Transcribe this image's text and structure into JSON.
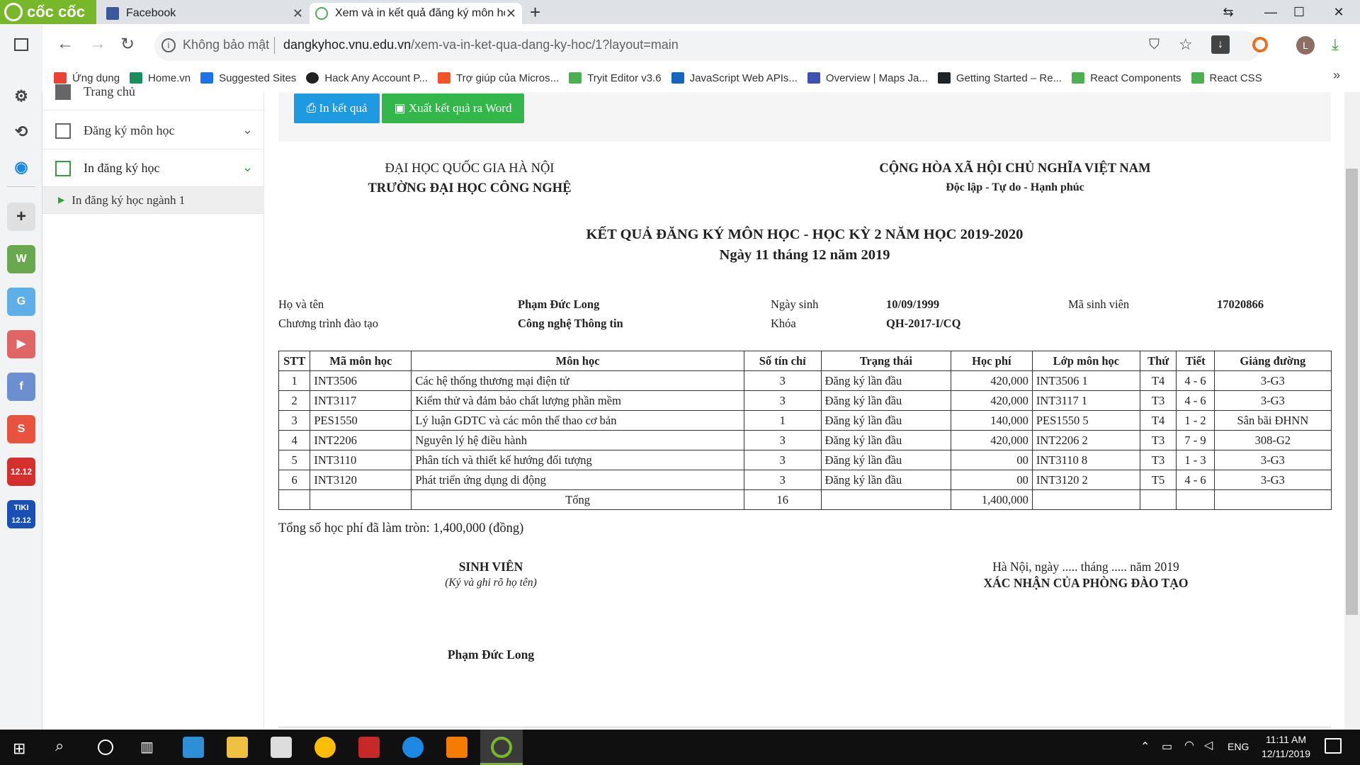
{
  "browser": {
    "brand": "cốc cốc",
    "tabs": [
      {
        "title": "Facebook",
        "favicon": "facebook-icon"
      },
      {
        "title": "Xem và in kết quả đăng ký môn họ",
        "favicon": "vnu-icon"
      }
    ],
    "security_label": "Không bảo mật",
    "url_host": "dangkyhoc.vnu.edu.vn",
    "url_path": "/xem-va-in-ket-qua-dang-ky-hoc/1?layout=main",
    "profile_initial": "L",
    "bookmarks": [
      {
        "label": "Ứng dụng",
        "color": "#e94335"
      },
      {
        "label": "Home.vn",
        "color": "#1a8f5c"
      },
      {
        "label": "Suggested Sites",
        "color": "#1a73e8"
      },
      {
        "label": "Hack Any Account P...",
        "color": "#222222"
      },
      {
        "label": "Trợ giúp của Micros...",
        "color": "#f35325"
      },
      {
        "label": "Tryit Editor v3.6",
        "color": "#4caf50"
      },
      {
        "label": "JavaScript Web APIs...",
        "color": "#1565c0"
      },
      {
        "label": "Overview | Maps Ja...",
        "color": "#3f51b5"
      },
      {
        "label": "Getting Started – Re...",
        "color": "#20232a"
      },
      {
        "label": "React Components",
        "color": "#4caf50"
      },
      {
        "label": "React CSS",
        "color": "#4caf50"
      }
    ]
  },
  "sidebar": {
    "items": [
      {
        "label": "Trang chủ"
      },
      {
        "label": "Đăng ký môn học"
      },
      {
        "label": "In đăng ký học"
      },
      {
        "label": "In đăng ký học ngành 1"
      }
    ]
  },
  "actions": {
    "print_label": "In kết quả",
    "export_label": "Xuất kết quả ra Word"
  },
  "header": {
    "left_line1": "ĐẠI HỌC QUỐC GIA HÀ NỘI",
    "left_line2": "TRƯỜNG ĐẠI HỌC CÔNG NGHỆ",
    "right_line1": "CỘNG HÒA XÃ HỘI CHỦ NGHĨA VIỆT NAM",
    "right_line2": "Độc lập - Tự do - Hạnh phúc",
    "title": "KẾT QUẢ ĐĂNG KÝ MÔN HỌC - HỌC KỲ 2 NĂM HỌC 2019-2020",
    "date": "Ngày 11 tháng 12 năm 2019"
  },
  "student": {
    "name_label": "Họ và tên",
    "name": "Phạm Đức Long",
    "dob_label": "Ngày sinh",
    "dob": "10/09/1999",
    "id_label": "Mã sinh viên",
    "id": "17020866",
    "program_label": "Chương trình đào tạo",
    "program": "Công nghệ Thông tin",
    "cohort_label": "Khóa",
    "cohort": "QH-2017-I/CQ"
  },
  "table": {
    "headers": [
      "STT",
      "Mã môn học",
      "Môn học",
      "Số tín chỉ",
      "Trạng thái",
      "Học phí",
      "Lớp môn học",
      "Thứ",
      "Tiết",
      "Giảng đường"
    ],
    "rows": [
      [
        "1",
        "INT3506",
        "Các hệ thống thương mại điện tử",
        "3",
        "Đăng ký lần đầu",
        "420,000",
        "INT3506 1",
        "T4",
        "4 - 6",
        "3-G3"
      ],
      [
        "2",
        "INT3117",
        "Kiểm thử và đảm bảo chất lượng phần mềm",
        "3",
        "Đăng ký lần đầu",
        "420,000",
        "INT3117 1",
        "T3",
        "4 - 6",
        "3-G3"
      ],
      [
        "3",
        "PES1550",
        "Lý luận GDTC và các môn thể thao cơ bản",
        "1",
        "Đăng ký lần đầu",
        "140,000",
        "PES1550 5",
        "T4",
        "1 - 2",
        "Sân bãi ĐHNN"
      ],
      [
        "4",
        "INT2206",
        "Nguyên lý hệ điều hành",
        "3",
        "Đăng ký lần đầu",
        "420,000",
        "INT2206 2",
        "T3",
        "7 - 9",
        "308-G2"
      ],
      [
        "5",
        "INT3110",
        "Phân tích và thiết kế hướng đối tượng",
        "3",
        "Đăng ký lần đầu",
        "00",
        "INT3110 8",
        "T3",
        "1 - 3",
        "3-G3"
      ],
      [
        "6",
        "INT3120",
        "Phát triển ứng dụng di động",
        "3",
        "Đăng ký lần đầu",
        "00",
        "INT3120 2",
        "T5",
        "4 - 6",
        "3-G3"
      ]
    ],
    "total_label": "Tổng",
    "total_credits": "16",
    "total_fee": "1,400,000"
  },
  "summary": "Tổng số học phí đã làm tròn: 1,400,000 (đồng)",
  "signature": {
    "student_title": "SINH VIÊN",
    "student_note": "(Ký và ghi rõ họ tên)",
    "student_name": "Phạm Đức Long",
    "place_date": "Hà Nội, ngày ..... tháng ..... năm 2019",
    "office_title": "XÁC NHẬN CỦA PHÒNG ĐÀO TẠO"
  },
  "taskbar": {
    "lang": "ENG",
    "time": "11:11 AM",
    "date": "12/11/2019"
  },
  "colors": {
    "brand_green": "#76b82a",
    "print_button": "#1e9ae0",
    "export_button": "#34b74a",
    "taskbar": "#101010"
  }
}
